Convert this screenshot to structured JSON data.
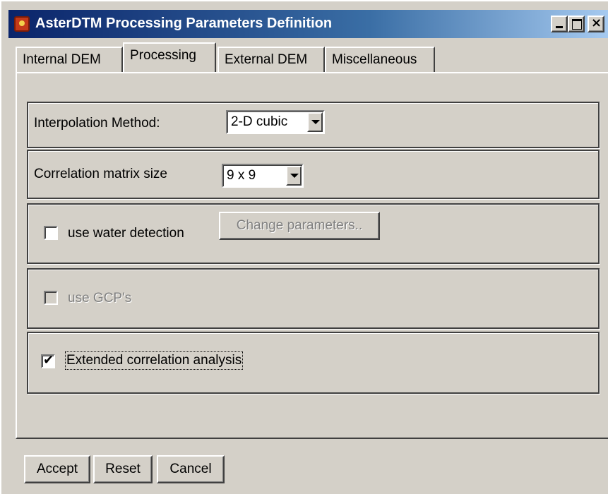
{
  "window": {
    "title": "AsterDTM Processing Parameters Definition"
  },
  "tabs": [
    {
      "label": "Internal DEM",
      "active": false
    },
    {
      "label": "Processing",
      "active": true
    },
    {
      "label": "External DEM",
      "active": false
    },
    {
      "label": "Miscellaneous",
      "active": false
    }
  ],
  "processing": {
    "interpolation": {
      "label": "Interpolation Method:",
      "value": "2-D cubic"
    },
    "correlation": {
      "label": "Correlation matrix size",
      "value": "9 x 9"
    },
    "water_detection": {
      "label": "use water detection",
      "checked": false,
      "button_label": "Change parameters.."
    },
    "gcps": {
      "label": "use GCP's",
      "checked": false,
      "enabled": false
    },
    "extended_correlation": {
      "label": "Extended correlation analysis",
      "checked": true
    }
  },
  "footer": {
    "accept_label": "Accept",
    "reset_label": "Reset",
    "cancel_label": "Cancel"
  },
  "colors": {
    "titlebar_start": "#0a246a",
    "titlebar_end": "#a6caf0",
    "face": "#d4d0c8"
  }
}
